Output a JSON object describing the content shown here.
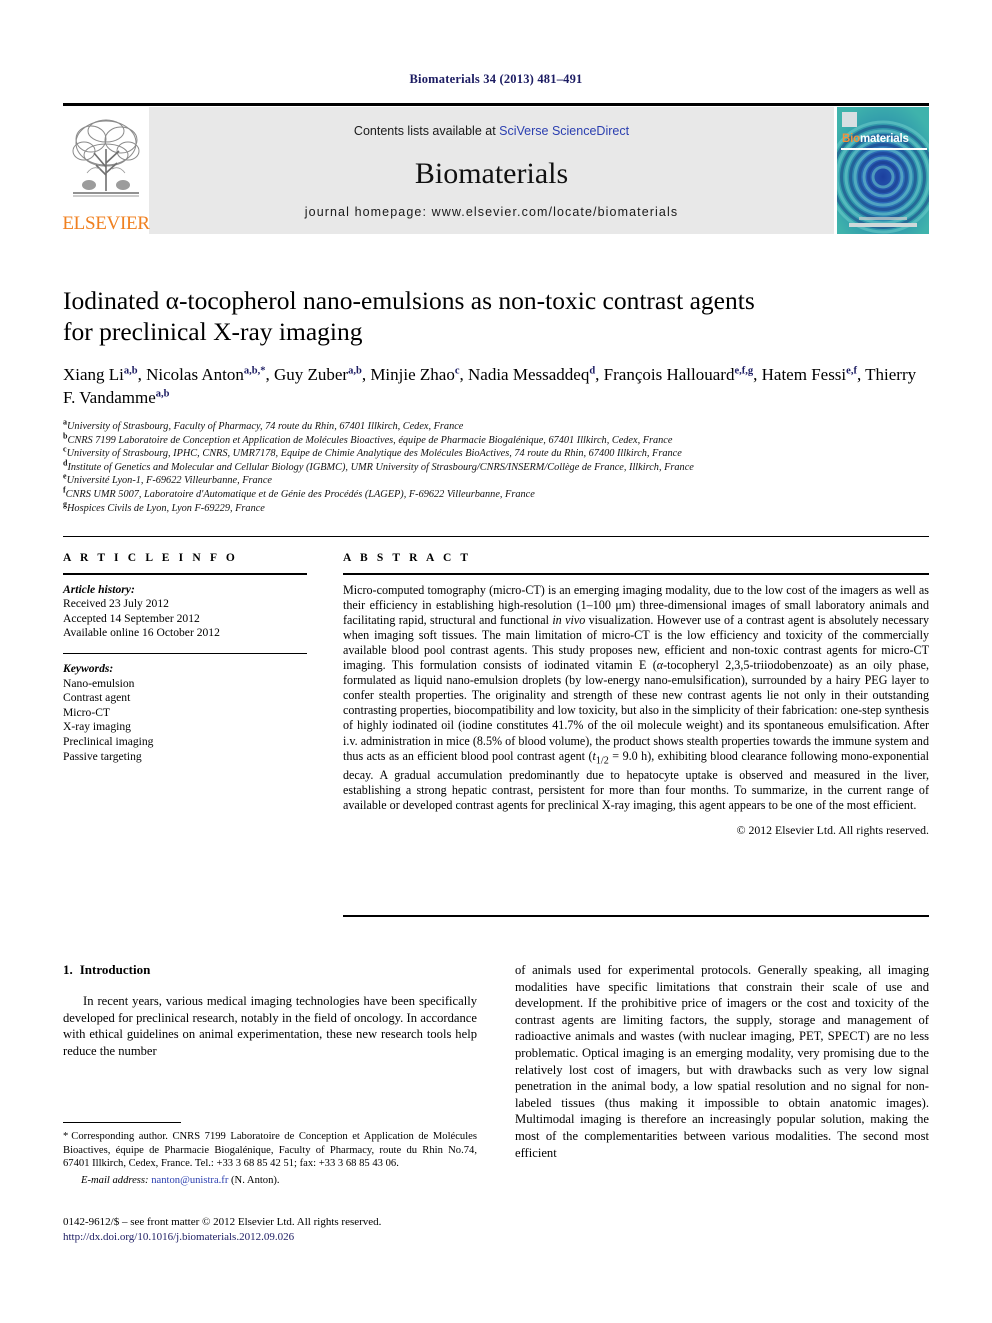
{
  "running_head": "Biomaterials 34 (2013) 481–491",
  "banner": {
    "publisher_name": "ELSEVIER",
    "contents_prefix": "Contents lists available at ",
    "sciencedirect_link": "SciVerse ScienceDirect",
    "journal_name": "Biomaterials",
    "homepage": "journal homepage: www.elsevier.com/locate/biomaterials",
    "cover": {
      "title_part1": "Bio",
      "title_part2": "materials"
    }
  },
  "article": {
    "title_line1": "Iodinated α-tocopherol nano-emulsions as non-toxic contrast agents",
    "title_line2": "for preclinical X-ray imaging",
    "authors": [
      {
        "name": "Xiang Li",
        "sup": "a,b",
        "sep": ", "
      },
      {
        "name": "Nicolas Anton",
        "sup": "a,b,*",
        "sep": ", "
      },
      {
        "name": "Guy Zuber",
        "sup": "a,b",
        "sep": ", "
      },
      {
        "name": "Minjie Zhao",
        "sup": "c",
        "sep": ", "
      },
      {
        "name": "Nadia Messaddeq",
        "sup": "d",
        "sep": ", "
      },
      {
        "name": "François Hallouard",
        "sup": "e,f,g",
        "sep": ", "
      },
      {
        "name": "Hatem Fessi",
        "sup": "e,f",
        "sep": ", "
      },
      {
        "name": "Thierry F. Vandamme",
        "sup": "a,b",
        "sep": ""
      }
    ],
    "affiliations": [
      {
        "mark": "a",
        "text": "University of Strasbourg, Faculty of Pharmacy, 74 route du Rhin, 67401 Illkirch, Cedex, France"
      },
      {
        "mark": "b",
        "text": "CNRS 7199 Laboratoire de Conception et Application de Molécules Bioactives, équipe de Pharmacie Biogalénique, 67401 Illkirch, Cedex, France"
      },
      {
        "mark": "c",
        "text": "University of Strasbourg, IPHC, CNRS, UMR7178, Equipe de Chimie Analytique des Molécules BioActives, 74 route du Rhin, 67400 Illkirch, France"
      },
      {
        "mark": "d",
        "text": "Institute of Genetics and Molecular and Cellular Biology (IGBMC), UMR University of Strasbourg/CNRS/INSERM/Collège de France, Illkirch, France"
      },
      {
        "mark": "e",
        "text": "Université Lyon-1, F-69622 Villeurbanne, France"
      },
      {
        "mark": "f",
        "text": "CNRS UMR 5007, Laboratoire d'Automatique et de Génie des Procédés (LAGEP), F-69622 Villeurbanne, France"
      },
      {
        "mark": "g",
        "text": "Hospices Civils de Lyon, Lyon F-69229, France"
      }
    ]
  },
  "article_info": {
    "heading": "A R T I C L E  I N F O",
    "history_label": "Article history:",
    "history": [
      "Received 23 July 2012",
      "Accepted 14 September 2012",
      "Available online 16 October 2012"
    ],
    "keywords_label": "Keywords:",
    "keywords": [
      "Nano-emulsion",
      "Contrast agent",
      "Micro-CT",
      "X-ray imaging",
      "Preclinical imaging",
      "Passive targeting"
    ]
  },
  "abstract": {
    "heading": "A B S T R A C T",
    "paragraph_1": "Micro-computed tomography (micro-CT) is an emerging imaging modality, due to the low cost of the imagers as well as their efficiency in establishing high-resolution (1–100 μm) three-dimensional images of small laboratory animals and facilitating rapid, structural and functional ",
    "paragraph_1_italic": "in vivo",
    "paragraph_2": " visualization. However use of a contrast agent is absolutely necessary when imaging soft tissues. The main limitation of micro-CT is the low efficiency and toxicity of the commercially available blood pool contrast agents. This study proposes new, efficient and non-toxic contrast agents for micro-CT imaging. This formulation consists of iodinated vitamin E (",
    "paragraph_2_italic": "α",
    "paragraph_3": "-tocopheryl 2,3,5-triiodobenzoate) as an oily phase, formulated as liquid nano-emulsion droplets (by low-energy nano-emulsification), surrounded by a hairy PEG layer to confer stealth properties. The originality and strength of these new contrast agents lie not only in their outstanding contrasting properties, biocompatibility and low toxicity, but also in the simplicity of their fabrication: one-step synthesis of highly iodinated oil (iodine constitutes 41.7% of the oil molecule weight) and its spontaneous emulsification. After i.v. administration in mice (8.5% of blood volume), the product shows stealth properties towards the immune system and thus acts as an efficient blood pool contrast agent (",
    "paragraph_3_italic": "t",
    "paragraph_3_sub": "1/2",
    "paragraph_4": " = 9.0 h), exhibiting blood clearance following mono-exponential decay. A gradual accumulation predominantly due to hepatocyte uptake is observed and measured in the liver, establishing a strong hepatic contrast, persistent for more than four months. To summarize, in the current range of available or developed contrast agents for preclinical X-ray imaging, this agent appears to be one of the most efficient.",
    "copyright": "© 2012 Elsevier Ltd. All rights reserved."
  },
  "body": {
    "section_number": "1.",
    "section_title": "Introduction",
    "left_paragraph": "In recent years, various medical imaging technologies have been specifically developed for preclinical research, notably in the field of oncology. In accordance with ethical guidelines on animal experimentation, these new research tools help reduce the number",
    "right_paragraph": "of animals used for experimental protocols. Generally speaking, all imaging modalities have specific limitations that constrain their scale of use and development. If the prohibitive price of imagers or the cost and toxicity of the contrast agents are limiting factors, the supply, storage and management of radioactive animals and wastes (with nuclear imaging, PET, SPECT) are no less problematic. Optical imaging is an emerging modality, very promising due to the relatively lost cost of imagers, but with drawbacks such as very low signal penetration in the animal body, a low spatial resolution and no signal for non-labeled tissues (thus making it impossible to obtain anatomic images). Multimodal imaging is therefore an increasingly popular solution, making the most of the complementarities between various modalities. The second most efficient"
  },
  "footnotes": {
    "corresponding_marker": "*",
    "corresponding_text": "Corresponding author. CNRS 7199 Laboratoire de Conception et Application de Molécules Bioactives, équipe de Pharmacie Biogalénique, Faculty of Pharmacy, route du Rhin No.74, 67401 Illkirch, Cedex, France. Tel.: +33 3 68 85 42 51; fax: +33 3 68 85 43 06.",
    "email_label": "E-mail address:",
    "email": "nanton@unistra.fr",
    "email_suffix": "(N. Anton).",
    "issn_line": "0142-9612/$ – see front matter © 2012 Elsevier Ltd. All rights reserved.",
    "doi": "http://dx.doi.org/10.1016/j.biomaterials.2012.09.026"
  }
}
